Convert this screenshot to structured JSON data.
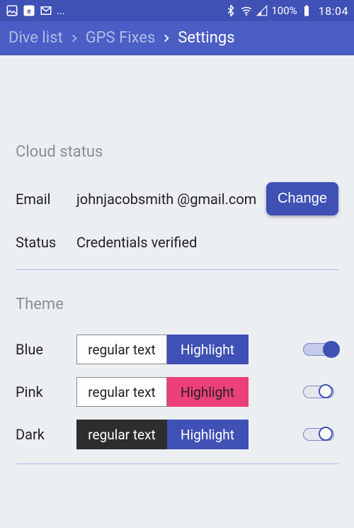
{
  "statusbar": {
    "battery_text": "100%",
    "time": "18:04",
    "notif_ellipsis": "..."
  },
  "breadcrumb": {
    "items": [
      {
        "label": "Dive list"
      },
      {
        "label": "GPS Fixes"
      },
      {
        "label": "Settings"
      }
    ]
  },
  "cloud": {
    "section_title": "Cloud status",
    "email_label": "Email",
    "email_value": "johnjacobsmith @gmail.com",
    "change_label": "Change",
    "status_label": "Status",
    "status_value": "Credentials verified"
  },
  "theme": {
    "section_title": "Theme",
    "regular_text": "regular text",
    "highlight_text": "Highlight",
    "rows": [
      {
        "name": "Blue",
        "selected": true
      },
      {
        "name": "Pink",
        "selected": false
      },
      {
        "name": "Dark",
        "selected": false
      }
    ]
  }
}
